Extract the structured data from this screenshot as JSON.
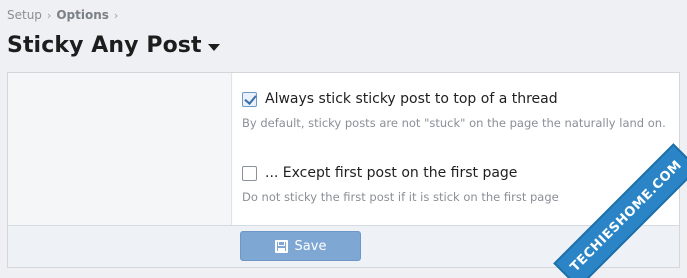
{
  "breadcrumb": {
    "items": [
      "Setup",
      "Options"
    ],
    "separator": "›"
  },
  "page": {
    "title": "Sticky Any Post"
  },
  "options": [
    {
      "label": "Always stick sticky post to top of a thread",
      "checked": true,
      "hint": "By default, sticky posts are not \"stuck\" on the page the naturally land on."
    },
    {
      "label": "... Except first post on the first page",
      "checked": false,
      "hint": "Do not sticky the first post if it is stick on the first page"
    }
  ],
  "footer": {
    "save_label": "Save",
    "save_icon": "save-icon"
  },
  "watermark": {
    "text": "TECHIESHOME.COM"
  },
  "colors": {
    "accent": "#7fa7d4",
    "watermark_bg": "#2a84c5",
    "checkbox_checked": "#3c6fa8"
  }
}
